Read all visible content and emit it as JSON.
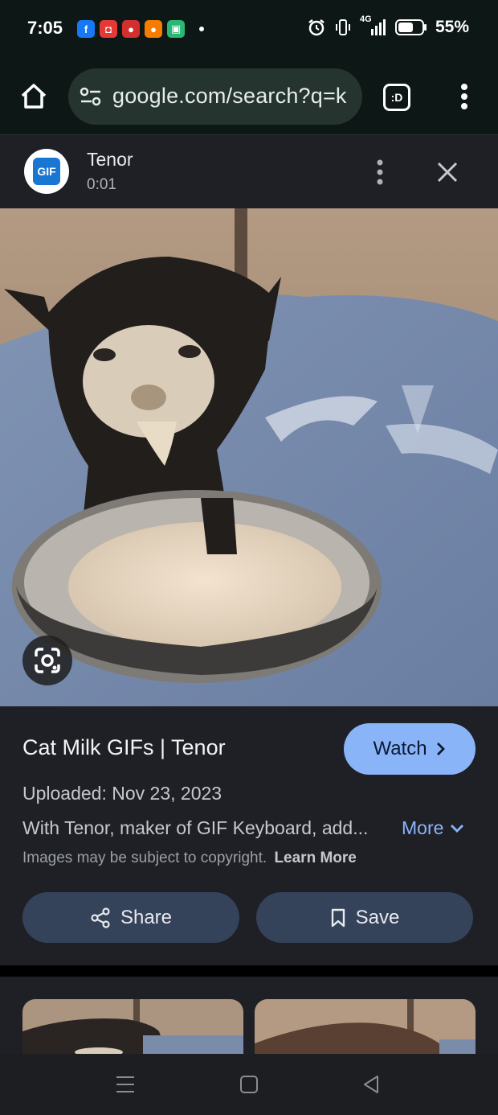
{
  "status_bar": {
    "time": "7:05",
    "battery": "55%",
    "network": "4G",
    "app_icons": [
      "facebook-icon",
      "camera-app-icon",
      "red-app-icon",
      "orange-app-icon",
      "green-app-icon"
    ]
  },
  "browser": {
    "url": "google.com/search?q=k",
    "tabs_label": ":D"
  },
  "source": {
    "name": "Tenor",
    "duration": "0:01",
    "avatar_text": "GIF"
  },
  "result": {
    "title": "Cat Milk GIFs | Tenor",
    "watch_label": "Watch",
    "uploaded": "Uploaded: Nov 23, 2023",
    "description": "With Tenor, maker of GIF Keyboard, add...",
    "more_label": "More",
    "copyright": "Images may be subject to copyright.",
    "learn_more": "Learn More",
    "share_label": "Share",
    "save_label": "Save"
  },
  "colors": {
    "accent": "#8ab4f8",
    "surface": "#1f2025",
    "button": "#34425a"
  }
}
